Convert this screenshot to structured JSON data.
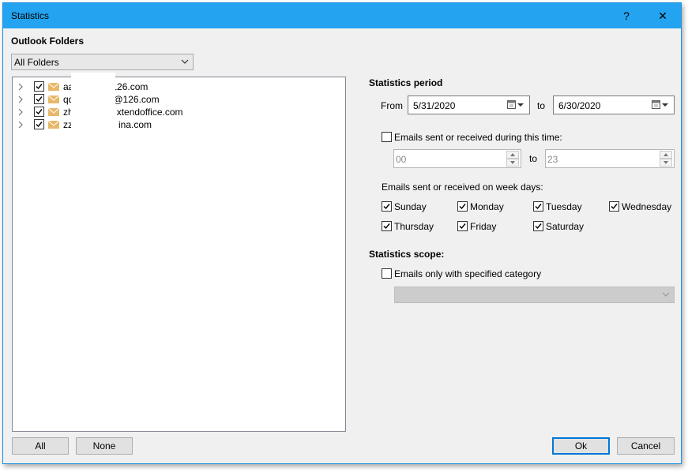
{
  "window": {
    "title": "Statistics",
    "help_label": "?",
    "close_label": "✕"
  },
  "left": {
    "section_label": "Outlook Folders",
    "folder_select": {
      "selected": "All Folders"
    },
    "accounts": [
      {
        "label": "aa",
        "suffix": "126.com",
        "checked": true
      },
      {
        "label": "qq",
        "suffix": "@126.com",
        "checked": true
      },
      {
        "label": "zh",
        "suffix": "xtendoffice.com",
        "checked": true
      },
      {
        "label": "zz",
        "suffix": "ina.com",
        "checked": true
      }
    ],
    "buttons": {
      "all": "All",
      "none": "None"
    }
  },
  "right": {
    "period": {
      "section_label": "Statistics period",
      "from_label": "From",
      "from_value": "5/31/2020",
      "to_label": "to",
      "to_value": "6/30/2020"
    },
    "time_filter": {
      "label": "Emails sent or received during this time:",
      "checked": false,
      "start_value": "00",
      "to_label": "to",
      "end_value": "23"
    },
    "weekdays": {
      "label": "Emails sent or received on week days:",
      "days": [
        {
          "label": "Sunday",
          "checked": true
        },
        {
          "label": "Monday",
          "checked": true
        },
        {
          "label": "Tuesday",
          "checked": true
        },
        {
          "label": "Wednesday",
          "checked": true
        },
        {
          "label": "Thursday",
          "checked": true
        },
        {
          "label": "Friday",
          "checked": true
        },
        {
          "label": "Saturday",
          "checked": true
        }
      ]
    },
    "scope": {
      "section_label": "Statistics scope:",
      "category_label": "Emails only with specified category",
      "category_checked": false,
      "category_selected": ""
    }
  },
  "footer": {
    "ok": "Ok",
    "cancel": "Cancel"
  },
  "colors": {
    "titlebar": "#23a3f0",
    "dialog_bg": "#f0f0f0",
    "folder_icon": "#e8b86a",
    "default_button_border": "#0078d7"
  }
}
